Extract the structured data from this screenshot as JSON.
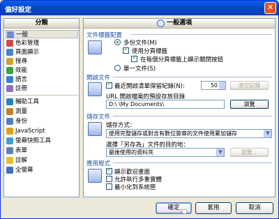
{
  "window": {
    "title": "偏好設定"
  },
  "left_panel": {
    "header": "分類",
    "items": [
      {
        "label": "一般",
        "icon": "gear-icon",
        "color": "#6b8fd6"
      },
      {
        "label": "色彩管理",
        "icon": "color-icon",
        "color": "#d04a4a"
      },
      {
        "label": "頁面顯示",
        "icon": "page-icon",
        "color": "#4a7fd0"
      },
      {
        "label": "搜尋",
        "icon": "search-icon",
        "color": "#d0a030"
      },
      {
        "label": "效能",
        "icon": "speed-icon",
        "color": "#3aa04a"
      },
      {
        "label": "語言",
        "icon": "globe-icon",
        "color": "#3a7fd0"
      },
      {
        "label": "註冊",
        "icon": "register-icon",
        "color": "#8a6fc0"
      },
      {
        "label": "輔助工具",
        "icon": "accessibility-icon",
        "color": "#2a80c0"
      },
      {
        "label": "測量",
        "icon": "ruler-icon",
        "color": "#c08030"
      },
      {
        "label": "身份",
        "icon": "identity-icon",
        "color": "#5080c0"
      },
      {
        "label": "JavaScript",
        "icon": "js-icon",
        "color": "#e0a020"
      },
      {
        "label": "螢幕快照工具",
        "icon": "snapshot-icon",
        "color": "#40a0d0"
      },
      {
        "label": "表單",
        "icon": "form-icon",
        "color": "#6080b0"
      },
      {
        "label": "註解",
        "icon": "comment-icon",
        "color": "#e0c030"
      },
      {
        "label": "全螢幕",
        "icon": "fullscreen-icon",
        "color": "#4070c0"
      }
    ]
  },
  "right_panel": {
    "header": "一般選項",
    "tab_section": {
      "title": "文件標籤配置",
      "radio_multi": "多份文件(M)",
      "check_tabs": "使用分頁標籤",
      "check_close": "在每個分頁標籤上顯示關閉按鈕",
      "radio_single": "單一文件(S)"
    },
    "recent_section": {
      "title": "開啟文件",
      "check_recent": "最近開啟清單保留紀錄(N):",
      "recent_count": "50",
      "clear_button": "清空記錄",
      "url_label": "URL 開啟檔案的預設存放目錄",
      "path_value": "D:\\                    \\My Documents\\",
      "browse_button": "瀏覽"
    },
    "save_section": {
      "title": "儲存文件",
      "mode_label": "儲存方式：",
      "mode_value": "使用完整儲存或對含有數位簽章的文件使用累加儲存",
      "dir_label": "選擇「另存為」文件的目的地：",
      "dir_value": "最後使用的資料夾",
      "browse_button": "瀏覽..."
    },
    "app_section": {
      "title": "應用程式",
      "check_splash": "顯示歡迎畫面",
      "check_multi": "允許執行多重實體",
      "check_tray": "最小化到系統匣"
    }
  },
  "buttons": {
    "ok": "確定",
    "apply": "套用",
    "cancel": "取消"
  }
}
